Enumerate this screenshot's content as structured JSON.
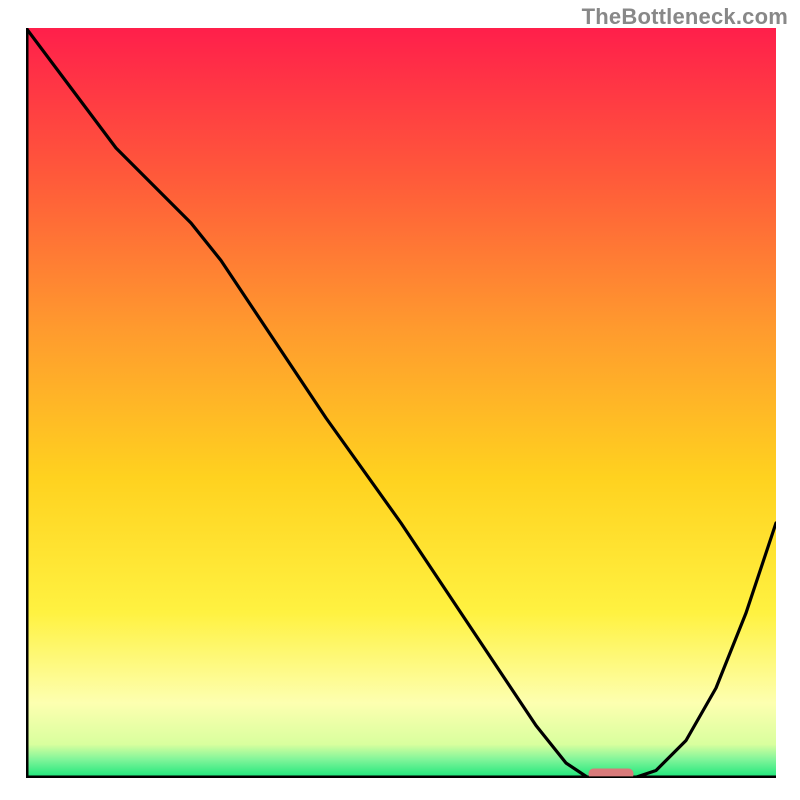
{
  "watermark": "TheBottleneck.com",
  "chart_data": {
    "type": "line",
    "title": "",
    "xlabel": "",
    "ylabel": "",
    "xlim": [
      0,
      100
    ],
    "ylim": [
      0,
      100
    ],
    "grid": false,
    "series": [
      {
        "name": "curve",
        "x": [
          0,
          6,
          12,
          22,
          26,
          30,
          40,
          50,
          60,
          68,
          72,
          75,
          78,
          81,
          84,
          88,
          92,
          96,
          100
        ],
        "y": [
          100,
          92,
          84,
          74,
          69,
          63,
          48,
          34,
          19,
          7,
          2,
          0,
          0,
          0,
          1,
          5,
          12,
          22,
          34
        ]
      }
    ],
    "flat_segment": {
      "x0": 75,
      "x1": 81,
      "y": 0.6,
      "color": "#d87a7a"
    },
    "gradient_stops": [
      {
        "offset": 0.0,
        "color": "#ff1f4b"
      },
      {
        "offset": 0.2,
        "color": "#ff5a3a"
      },
      {
        "offset": 0.4,
        "color": "#ff9a2e"
      },
      {
        "offset": 0.6,
        "color": "#ffd21f"
      },
      {
        "offset": 0.78,
        "color": "#fff241"
      },
      {
        "offset": 0.9,
        "color": "#fdffb0"
      },
      {
        "offset": 0.955,
        "color": "#d9ff9e"
      },
      {
        "offset": 0.975,
        "color": "#82f59a"
      },
      {
        "offset": 1.0,
        "color": "#19e67a"
      }
    ],
    "axis_color": "#000000",
    "curve_color": "#000000"
  }
}
